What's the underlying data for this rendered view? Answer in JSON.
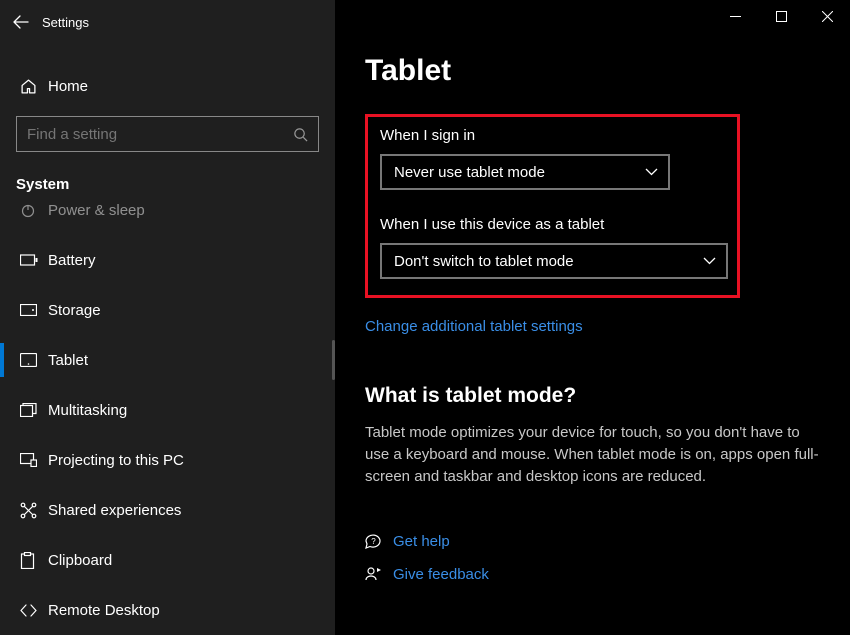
{
  "window": {
    "title": "Settings"
  },
  "sidebar": {
    "home": "Home",
    "searchPlaceholder": "Find a setting",
    "section": "System",
    "items": [
      {
        "label": "Power & sleep",
        "active": false
      },
      {
        "label": "Battery",
        "active": false
      },
      {
        "label": "Storage",
        "active": false
      },
      {
        "label": "Tablet",
        "active": true
      },
      {
        "label": "Multitasking",
        "active": false
      },
      {
        "label": "Projecting to this PC",
        "active": false
      },
      {
        "label": "Shared experiences",
        "active": false
      },
      {
        "label": "Clipboard",
        "active": false
      },
      {
        "label": "Remote Desktop",
        "active": false
      }
    ]
  },
  "main": {
    "title": "Tablet",
    "signInLabel": "When I sign in",
    "signInValue": "Never use tablet mode",
    "deviceLabel": "When I use this device as a tablet",
    "deviceValue": "Don't switch to tablet mode",
    "additionalLink": "Change additional tablet settings",
    "whatIsHeading": "What is tablet mode?",
    "whatIsBody": "Tablet mode optimizes your device for touch, so you don't have to use a keyboard and mouse. When tablet mode is on, apps open full-screen and taskbar and desktop icons are reduced.",
    "getHelp": "Get help",
    "giveFeedback": "Give feedback"
  }
}
